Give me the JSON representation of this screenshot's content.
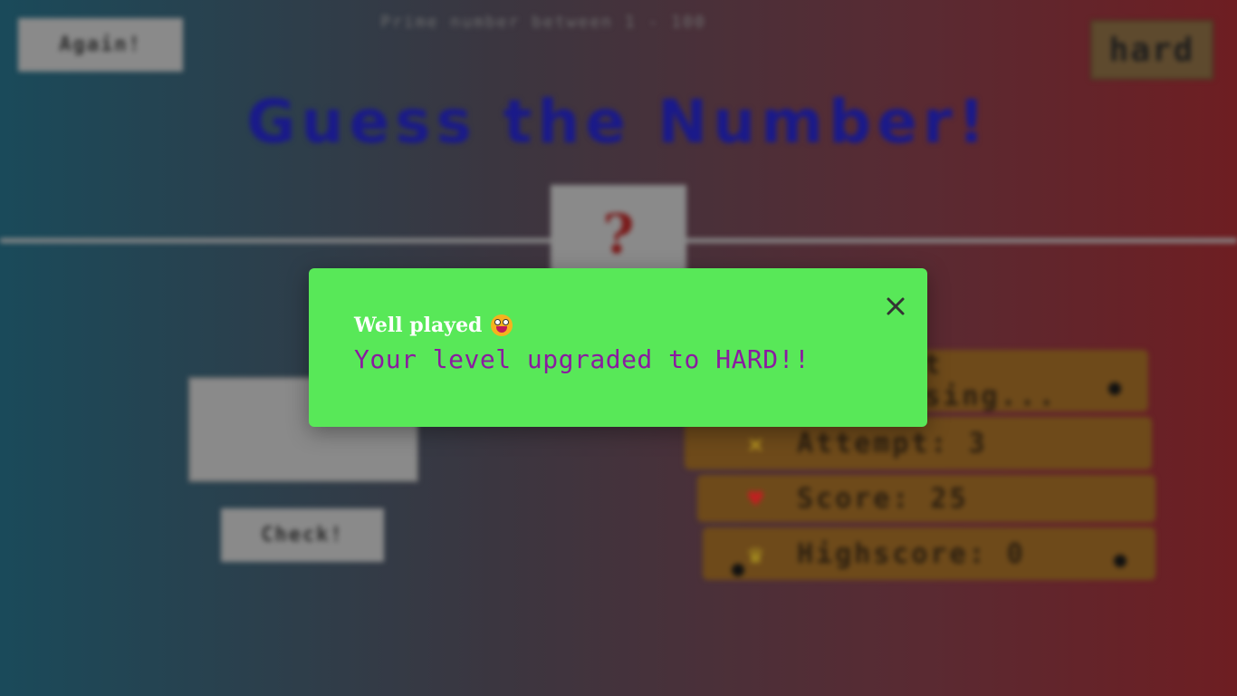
{
  "header": {
    "again_label": "Again!",
    "range_text": "Prime number between 1 - 100",
    "level_label": "hard"
  },
  "main": {
    "title": "Guess the Number!",
    "secret_placeholder": "?",
    "check_label": "Check!"
  },
  "scoreboard": {
    "status_text": "Start guessing...",
    "attempt_label": "Attempt: 3",
    "score_label": "Score: 25",
    "highscore_label": "Highscore: 0",
    "icons": [
      "attempt-icon",
      "heart-icon",
      "trophy-icon"
    ]
  },
  "modal": {
    "title": "Well played",
    "message": "Your level upgraded to HARD!!",
    "background_color": "#58e858",
    "message_color": "#8a1ba0"
  }
}
